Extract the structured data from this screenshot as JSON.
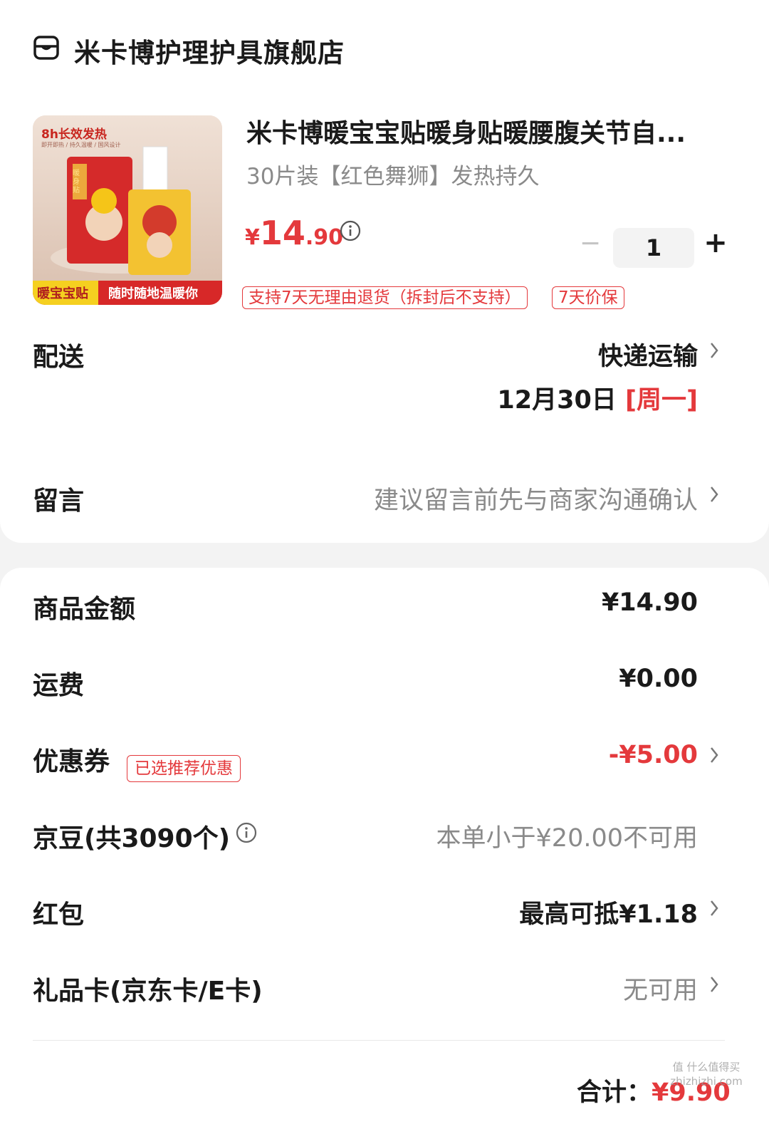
{
  "store": {
    "icon": "store-icon",
    "name": "米卡博护理护具旗舰店"
  },
  "product": {
    "title": "米卡博暖宝宝贴暖身贴暖腰腹关节自...",
    "spec": "30片装【红色舞狮】发热持久",
    "price_currency": "¥",
    "price_int": "14",
    "price_dec": ".90",
    "quantity": "1",
    "image_texts": {
      "top": "8h长效发热",
      "sub": "即开即热 / 持久温暖 / 国风设计",
      "box": "暖身贴",
      "bottom_left": "暖宝宝贴",
      "bottom_right": "随时随地温暖你"
    },
    "tags": [
      "支持7天无理由退货（拆封后不支持）",
      "7天价保"
    ]
  },
  "delivery": {
    "label": "配送",
    "method": "快递运输",
    "date": "12月30日",
    "weekday": "[周一]"
  },
  "message": {
    "label": "留言",
    "placeholder": "建议留言前先与商家沟通确认"
  },
  "summary": {
    "goods": {
      "label": "商品金额",
      "value": "¥14.90"
    },
    "shipping": {
      "label": "运费",
      "value": "¥0.00"
    },
    "coupon": {
      "label": "优惠券",
      "tag": "已选推荐优惠",
      "value": "-¥5.00"
    },
    "jingdou": {
      "label": "京豆(共3090个)",
      "value": "本单小于¥20.00不可用"
    },
    "redpacket": {
      "label": "红包",
      "value": "最高可抵¥1.18"
    },
    "giftcard": {
      "label": "礼品卡(京东卡/E卡)",
      "value": "无可用"
    }
  },
  "total": {
    "label": "合计：",
    "value": "¥9.90"
  },
  "watermark": "值 什么值得买 zhizhizhi.com",
  "colors": {
    "accent": "#e4393c",
    "gray_text": "#8a8a8a",
    "background": "#f3f3f3"
  }
}
